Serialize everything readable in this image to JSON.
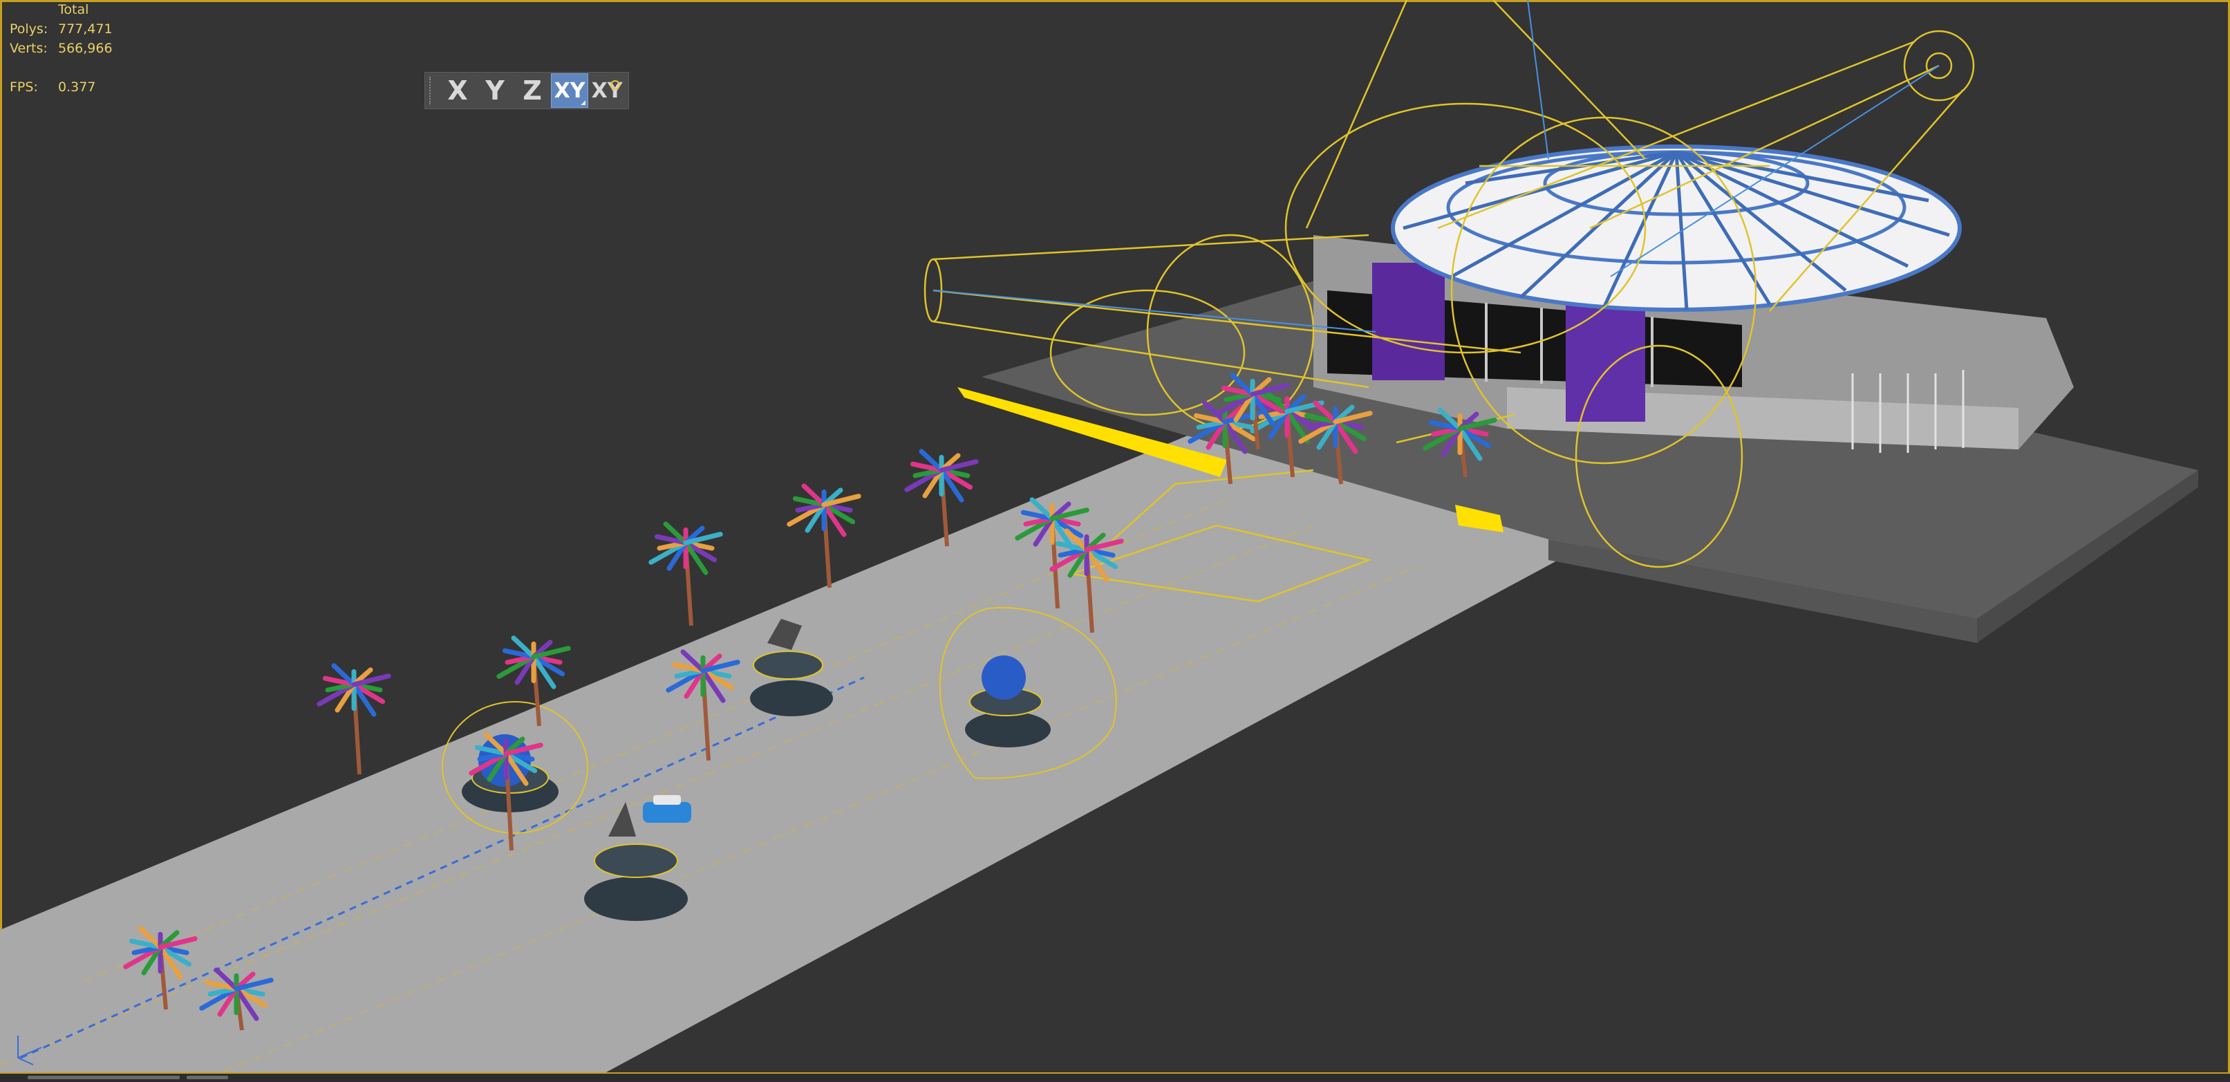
{
  "stats": {
    "header": "Total",
    "polys_label": "Polys:",
    "polys_value": "777,471",
    "verts_label": "Verts:",
    "verts_value": "566,966",
    "fps_label": "FPS:",
    "fps_value": "0.377"
  },
  "axis_toolbar": {
    "buttons": [
      {
        "label": "X",
        "active": false
      },
      {
        "label": "Y",
        "active": false
      },
      {
        "label": "Z",
        "active": false
      },
      {
        "label": "XY",
        "active": true
      },
      {
        "label": "XY",
        "active": false
      }
    ]
  },
  "colors": {
    "viewport_bg": "#343434",
    "helper_yellow": "#e8c92c",
    "ground": "#a8a8a8",
    "platform": "#5a5a5a",
    "dome_white": "#f0f0f2",
    "dome_blue": "#4a78c8",
    "banner_purple": "#6a2fa8",
    "sphere_blue": "#2a5cc8",
    "trunk_brown": "#a05a3a"
  },
  "icons": {
    "axis_tripod": "axis-tripod-icon",
    "toolbar_grip": "grip-icon"
  }
}
